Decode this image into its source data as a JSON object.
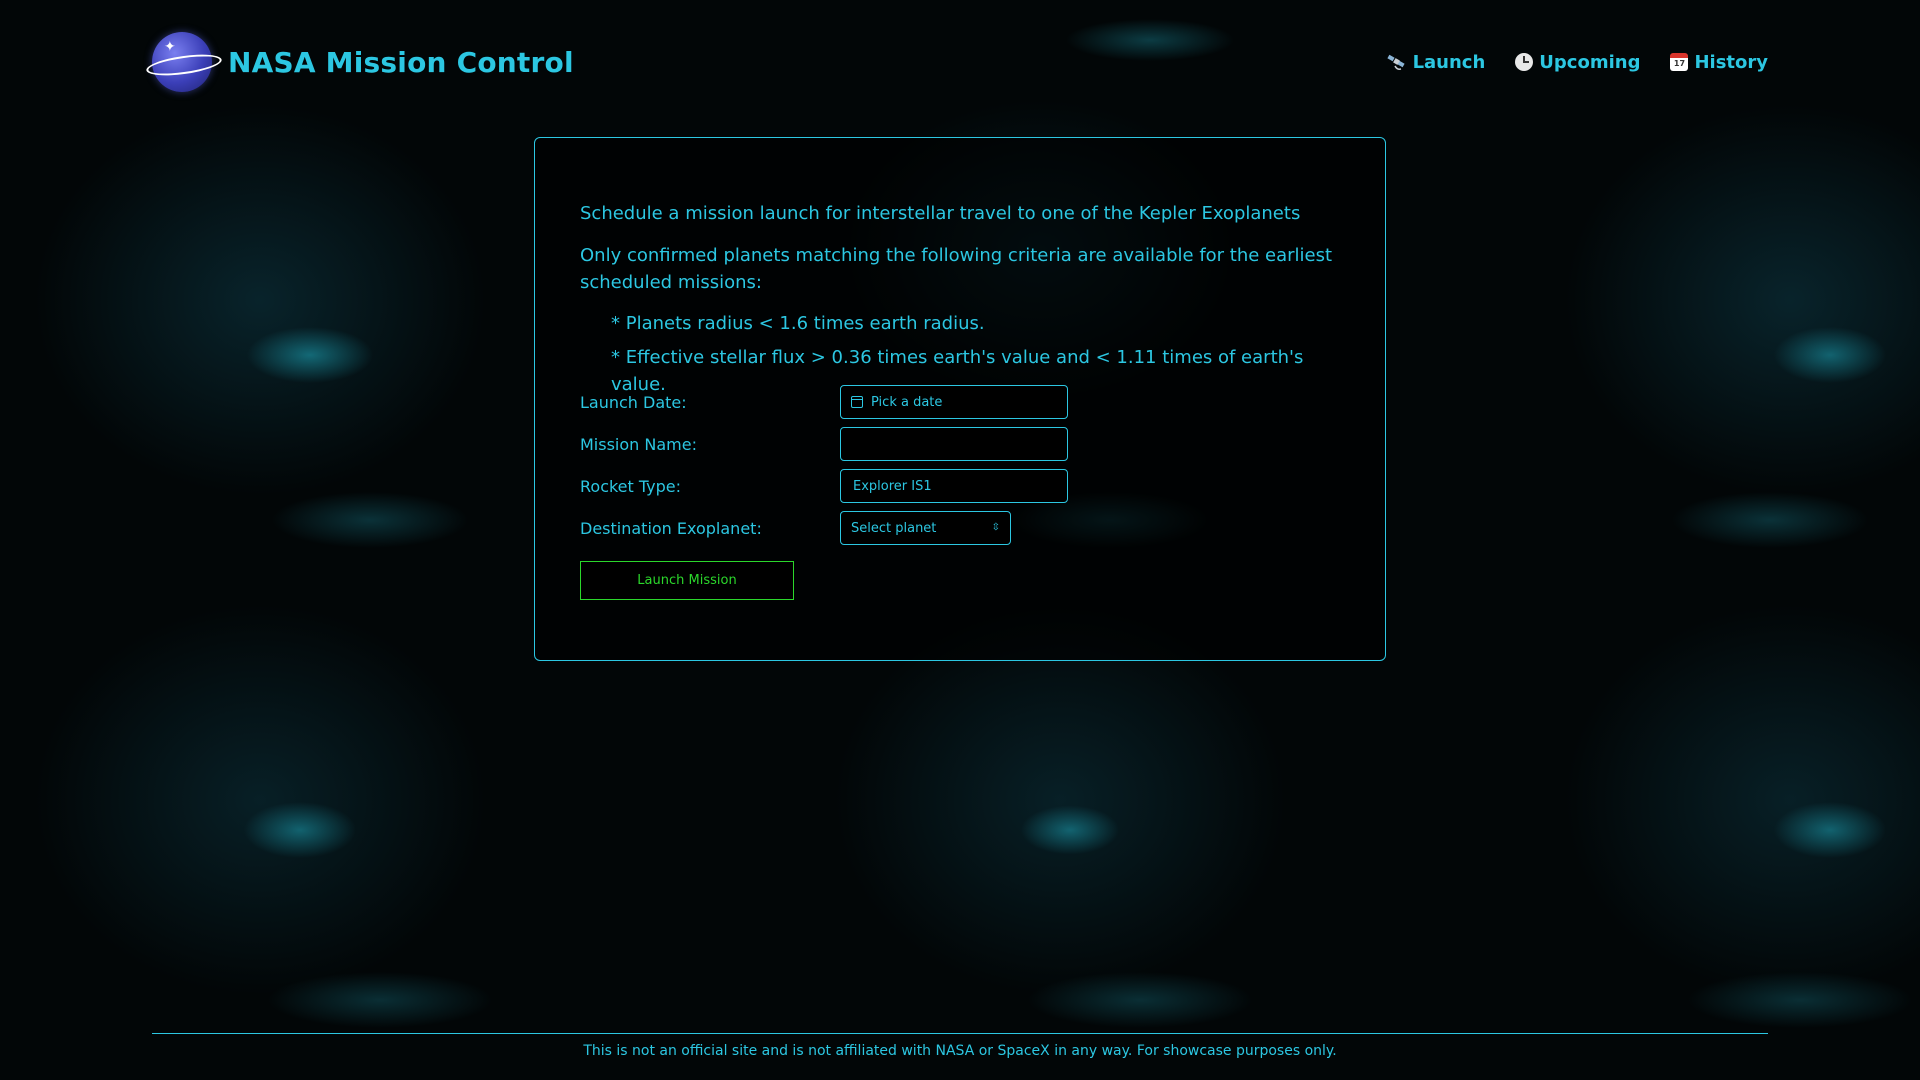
{
  "header": {
    "title": "NASA Mission Control",
    "nav": [
      {
        "label": "Launch",
        "icon": "satellite-icon"
      },
      {
        "label": "Upcoming",
        "icon": "clock-icon"
      },
      {
        "label": "History",
        "icon": "calendar-icon"
      }
    ],
    "calendar_icon_text": "17"
  },
  "intro": {
    "line1": "Schedule a mission launch for interstellar travel to one of the Kepler Exoplanets",
    "line2": "Only confirmed planets matching the following criteria are available for the earliest scheduled missions:",
    "criteria": [
      "* Planets radius < 1.6 times earth radius.",
      "* Effective stellar flux > 0.36 times earth's value and < 1.11 times of earth's value."
    ]
  },
  "form": {
    "launch_date_label": "Launch Date:",
    "launch_date_placeholder": "Pick a date",
    "mission_name_label": "Mission Name:",
    "mission_name_value": "",
    "rocket_type_label": "Rocket Type:",
    "rocket_type_value": "Explorer IS1",
    "destination_label": "Destination Exoplanet:",
    "destination_value": "Select planet",
    "submit_label": "Launch Mission"
  },
  "footer": {
    "text": "This is not an official site and is not affiliated with NASA or SpaceX in any way. For showcase purposes only."
  },
  "colors": {
    "accent": "#2cc7e2",
    "button": "#2bd72b",
    "background": "#020607"
  }
}
